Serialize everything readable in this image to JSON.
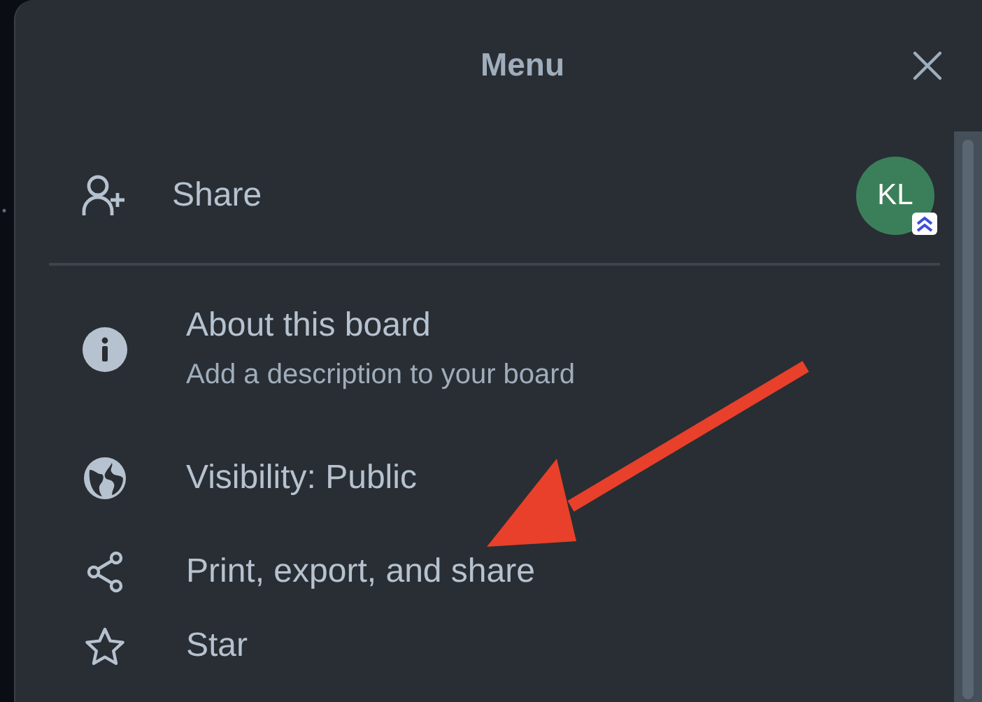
{
  "header": {
    "title": "Menu"
  },
  "share": {
    "label": "Share",
    "avatar": {
      "initials": "KL"
    }
  },
  "items": [
    {
      "kind": "info",
      "title": "About this board",
      "subtitle": "Add a description to your board"
    },
    {
      "kind": "globe",
      "title": "Visibility: Public"
    },
    {
      "kind": "share",
      "title": "Print, export, and share"
    },
    {
      "kind": "star",
      "title": "Star"
    }
  ]
}
